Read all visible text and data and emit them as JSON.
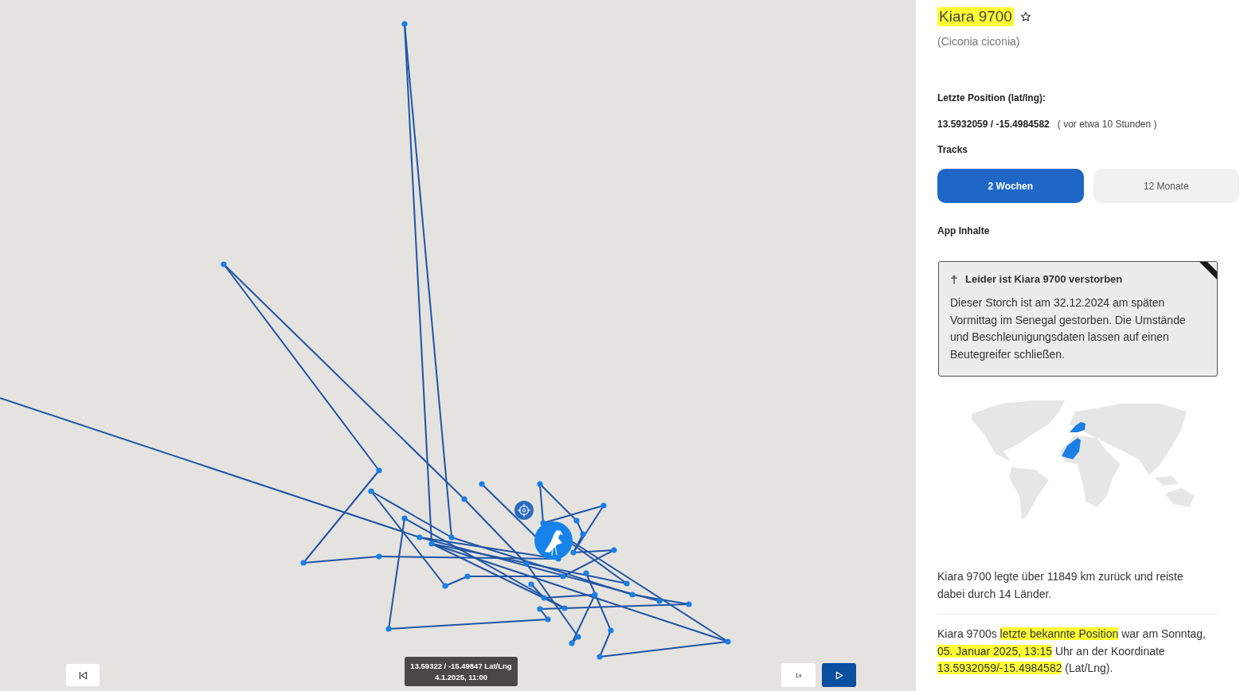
{
  "map": {
    "tooltip": {
      "lines": [
        "13.59322 / -15.49847 Lat/Lng",
        "4.1.2025, 11:00"
      ]
    },
    "speed": "1x"
  },
  "panel": {
    "title": {
      "text": "Kiara 9700",
      "highlighted": true
    },
    "favorite": false,
    "species": "(Ciconia ciconia)",
    "position_label": "Letzte Position (lat/lng):",
    "position_value": "13.5932059 / -15.4984582",
    "position_age": "( vor etwa 10 Stunden )",
    "tracks_label": "Tracks",
    "tracks": [
      {
        "label": "2 Wochen",
        "selected": true
      },
      {
        "label": "12 Monate",
        "selected": false
      }
    ],
    "content_label": "App Inhalte",
    "notice": {
      "title": "Leider ist Kiara 9700 verstorben",
      "body": "Dieser Storch ist am 32.12.2024 am späten Vormittag im Senegal gestorben. Die Umstände und Beschleunigungsdaten lassen auf einen Beutegreifer schließen."
    },
    "summary": "Kiara 9700 legte über 11849 km zurück und reiste dabei durch 14 Länder.",
    "last_seen": [
      {
        "text": "Kiara 9700s ",
        "highlighted": false
      },
      {
        "text": "letzte bekannte Position",
        "highlighted": true
      },
      {
        "text": " war am Sonntag, ",
        "highlighted": false
      },
      {
        "text": "05. Januar 2025, 13:15",
        "highlighted": true
      },
      {
        "text": " Uhr an der Koordinate ",
        "highlighted": false
      },
      {
        "text": "13.5932059/-15.4984582",
        "highlighted": true
      },
      {
        "text": " (Lat/Lng).",
        "highlighted": false
      }
    ]
  }
}
